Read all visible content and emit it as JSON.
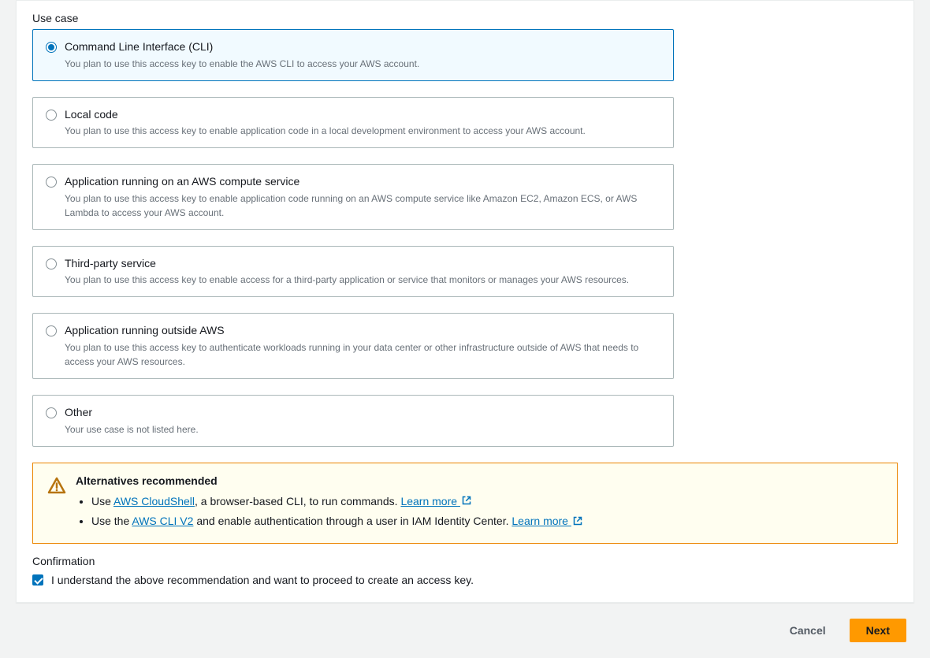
{
  "sectionLabel": "Use case",
  "options": [
    {
      "title": "Command Line Interface (CLI)",
      "desc": "You plan to use this access key to enable the AWS CLI to access your AWS account.",
      "selected": true
    },
    {
      "title": "Local code",
      "desc": "You plan to use this access key to enable application code in a local development environment to access your AWS account.",
      "selected": false
    },
    {
      "title": "Application running on an AWS compute service",
      "desc": "You plan to use this access key to enable application code running on an AWS compute service like Amazon EC2, Amazon ECS, or AWS Lambda to access your AWS account.",
      "selected": false
    },
    {
      "title": "Third-party service",
      "desc": "You plan to use this access key to enable access for a third-party application or service that monitors or manages your AWS resources.",
      "selected": false
    },
    {
      "title": "Application running outside AWS",
      "desc": "You plan to use this access key to authenticate workloads running in your data center or other infrastructure outside of AWS that needs to access your AWS resources.",
      "selected": false
    },
    {
      "title": "Other",
      "desc": "Your use case is not listed here.",
      "selected": false
    }
  ],
  "alert": {
    "title": "Alternatives recommended",
    "items": [
      {
        "prefix": "Use ",
        "link1": "AWS CloudShell",
        "mid": ", a browser-based CLI, to run commands. ",
        "learn": "Learn more"
      },
      {
        "prefix": "Use the ",
        "link1": "AWS CLI V2",
        "mid": " and enable authentication through a user in IAM Identity Center. ",
        "learn": "Learn more"
      }
    ]
  },
  "confirmation": {
    "label": "Confirmation",
    "text": "I understand the above recommendation and want to proceed to create an access key.",
    "checked": true
  },
  "buttons": {
    "cancel": "Cancel",
    "next": "Next"
  }
}
